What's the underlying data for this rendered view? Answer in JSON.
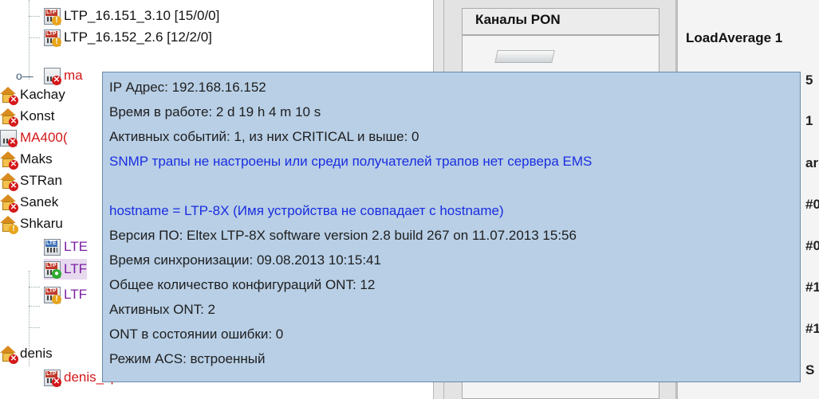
{
  "tree": {
    "nodes": [
      {
        "label": "LTP_16.151_3.10 [15/0/0]",
        "color": "#111111",
        "icon": "ltp-device-ok-icon"
      },
      {
        "label": "LTP_16.152_2.6 [12/2/0]",
        "color": "#111111",
        "icon": "ltp-device-warning-icon"
      },
      {
        "label": "ma",
        "color": "#d4181a",
        "icon": "device-error-icon"
      },
      {
        "label": "Kachay",
        "color": "#111111",
        "icon": "house-error-icon"
      },
      {
        "label": "Konst",
        "color": "#111111",
        "icon": "house-error-icon"
      },
      {
        "label": "MA400(",
        "color": "#d4181a",
        "icon": "device-error-icon"
      },
      {
        "label": "Maks",
        "color": "#111111",
        "icon": "house-error-icon"
      },
      {
        "label": "STRan",
        "color": "#111111",
        "icon": "house-error-icon"
      },
      {
        "label": "Sanek",
        "color": "#111111",
        "icon": "house-error-icon"
      },
      {
        "label": "Shkaru",
        "color": "#111111",
        "icon": "house-warning-icon"
      },
      {
        "label": "LTE",
        "color": "#7a1fa2",
        "icon": "ltp-device-icon"
      },
      {
        "label": "LTF",
        "color": "#7a1fa2",
        "icon": "ltp-device-ok-icon"
      },
      {
        "label": "LTF",
        "color": "#7a1fa2",
        "icon": "ltp-device-warning-icon"
      },
      {
        "label": "denis",
        "color": "#111111",
        "icon": "house-error-icon"
      },
      {
        "label": "denis_ltp8x",
        "color": "#d4181a",
        "icon": "ltp-device-error-icon"
      }
    ]
  },
  "middle": {
    "tab_label": "Каналы PON"
  },
  "right": {
    "load_label": "LoadAverage 1",
    "values": [
      "5",
      "1",
      "ar",
      "#0",
      "#0",
      "#1",
      "#1",
      "S"
    ]
  },
  "tooltip": {
    "lines": [
      {
        "text": "IP Адрес: 192.168.16.152",
        "style": "normal"
      },
      {
        "text": "Время в работе: 2 d 19 h 4 m 10 s",
        "style": "normal"
      },
      {
        "text": "Активных событий: 1, из них CRITICAL и выше: 0",
        "style": "normal"
      },
      {
        "text": "SNMP трапы не настроены или среди получателей трапов нет сервера EMS",
        "style": "blue"
      },
      {
        "text": "",
        "style": "normal"
      },
      {
        "text": "hostname = LTP-8X (Имя устройства не совпадает с hostname)",
        "style": "blue"
      },
      {
        "text": "Версия ПО: Eltex LTP-8X software version 2.8 build 267 on 11.07.2013 15:56",
        "style": "normal"
      },
      {
        "text": "Время синхронизации: 09.08.2013 10:15:41",
        "style": "normal"
      },
      {
        "text": "Общее количество конфигураций ONT: 12",
        "style": "normal"
      },
      {
        "text": "Активных ONT: 2",
        "style": "normal"
      },
      {
        "text": "ONT в состоянии ошибки: 0",
        "style": "normal"
      },
      {
        "text": "Режим ACS: встроенный",
        "style": "normal"
      }
    ]
  }
}
